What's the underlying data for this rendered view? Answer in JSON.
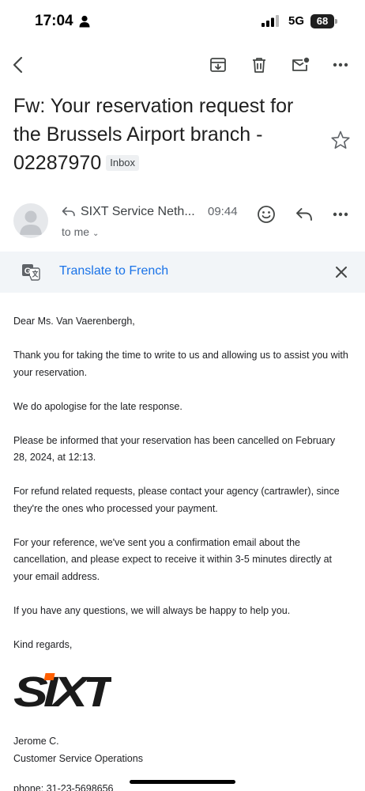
{
  "status_bar": {
    "time": "17:04",
    "network": "5G",
    "battery": "68"
  },
  "toolbar": {
    "icons": [
      "back-arrow-icon",
      "archive-icon",
      "delete-icon",
      "mark-unread-icon",
      "more-icon"
    ]
  },
  "subject": {
    "title": "Fw: Your reservation request for the Brussels Airport branch - 02287970",
    "label": "Inbox"
  },
  "sender": {
    "name": "SIXT Service Neth...",
    "time": "09:44",
    "recipient": "to me"
  },
  "translate": {
    "link": "Translate to French"
  },
  "body": {
    "paragraphs": [
      "Dear Ms. Van Vaerenbergh,",
      "Thank you for taking the time to write to us and allowing us to assist you with your reservation.",
      "We do apologise for the late response.",
      "Please be informed that your reservation has been cancelled on February 28, 2024, at 12:13.",
      "For refund related requests, please contact your agency (cartrawler), since they're the ones who processed your payment.",
      "For your reference, we've sent you a confirmation email about the cancellation, and please expect to receive it within 3-5 minutes directly at your email address.",
      "If you have any questions, we will always be happy to help you.",
      "Kind regards,"
    ],
    "logo_text": "SIXT",
    "signature_name": "Jerome C.",
    "signature_title": "Customer Service Operations",
    "phone": "phone: 31-23-5698656"
  },
  "colors": {
    "link_blue": "#1a73e8",
    "translate_bg": "#f2f5f8",
    "logo_orange": "#ff5f00"
  }
}
